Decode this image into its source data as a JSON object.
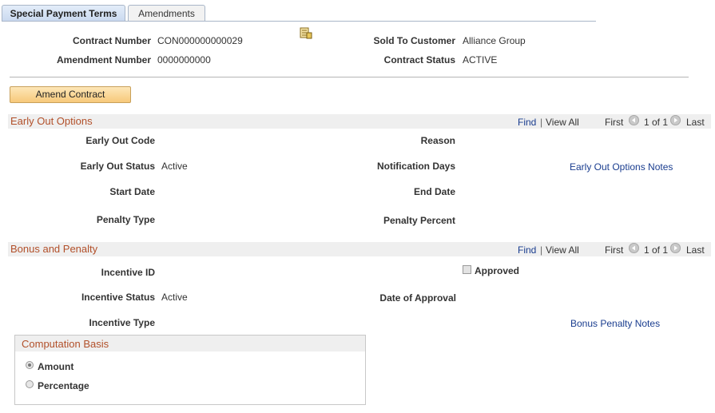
{
  "tabs": [
    {
      "label": "Special Payment Terms",
      "active": true
    },
    {
      "label": "Amendments",
      "active": false
    }
  ],
  "header": {
    "contract_number_label": "Contract Number",
    "contract_number": "CON000000000029",
    "amendment_number_label": "Amendment Number",
    "amendment_number": "0000000000",
    "sold_to_label": "Sold To Customer",
    "sold_to": "Alliance Group",
    "status_label": "Contract Status",
    "status": "ACTIVE"
  },
  "amend_button": "Amend Contract",
  "early_out": {
    "title": "Early Out Options",
    "nav": {
      "find": "Find",
      "sep": "|",
      "view_all": "View All",
      "first": "First",
      "count": "1 of 1",
      "last": "Last"
    },
    "code_label": "Early Out Code",
    "reason_label": "Reason",
    "status_label": "Early Out Status",
    "status": "Active",
    "notification_label": "Notification Days",
    "notes_link": "Early Out Options Notes",
    "start_label": "Start Date",
    "end_label": "End Date",
    "penalty_type_label": "Penalty Type",
    "penalty_percent_label": "Penalty Percent"
  },
  "bonus": {
    "title": "Bonus and Penalty",
    "nav": {
      "find": "Find",
      "sep": "|",
      "view_all": "View All",
      "first": "First",
      "count": "1 of 1",
      "last": "Last"
    },
    "incentive_id_label": "Incentive ID",
    "approved_label": "Approved",
    "incentive_status_label": "Incentive Status",
    "incentive_status": "Active",
    "date_approval_label": "Date of Approval",
    "incentive_type_label": "Incentive Type",
    "notes_link": "Bonus Penalty Notes"
  },
  "computation": {
    "title": "Computation Basis",
    "options": [
      {
        "label": "Amount",
        "selected": true
      },
      {
        "label": "Percentage",
        "selected": false
      }
    ]
  },
  "icons": {
    "header_icon": "document-list-icon",
    "prev": "previous-arrow-icon",
    "next": "next-arrow-icon"
  },
  "colors": {
    "section_title": "#b2502a",
    "link": "#1a3d8f",
    "button": "#f7c97a"
  }
}
